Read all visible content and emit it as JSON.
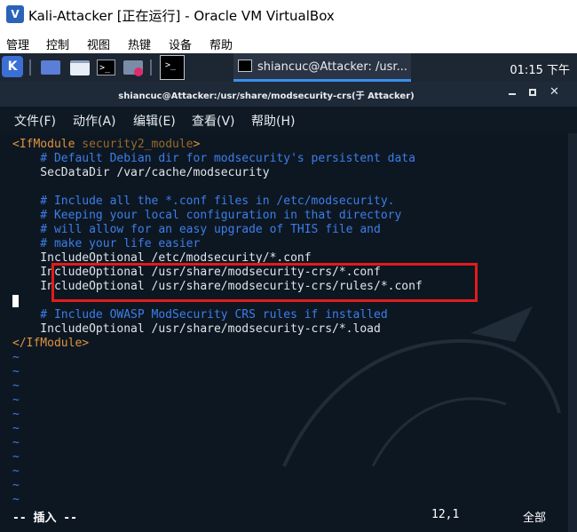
{
  "window": {
    "title": "Kali-Attacker [正在运行] - Oracle VM VirtualBox"
  },
  "vb_menu": [
    "管理",
    "控制",
    "视图",
    "热键",
    "设备",
    "帮助"
  ],
  "panel": {
    "task_label": "shiancuc@Attacker: /usr...",
    "clock": "01:15 下午"
  },
  "terminal": {
    "title": "shiancuc@Attacker:/usr/share/modsecurity-crs(于 Attacker)",
    "menu": [
      "文件(F)",
      "动作(A)",
      "编辑(E)",
      "查看(V)",
      "帮助(H)"
    ]
  },
  "editor": {
    "lines": {
      "l1_tag_open": "<IfModule ",
      "l1_attr": "security2_module",
      "l1_tag_close": ">",
      "l2": "    # Default Debian dir for modsecurity's persistent data",
      "l3": "    SecDataDir /var/cache/modsecurity",
      "l4": "",
      "l5": "    # Include all the *.conf files in /etc/modsecurity.",
      "l6": "    # Keeping your local configuration in that directory",
      "l7": "    # will allow for an easy upgrade of THIS file and",
      "l8": "    # make your life easier",
      "l9": "    IncludeOptional /etc/modsecurity/*.conf",
      "l10": "    IncludeOptional /usr/share/modsecurity-crs/*.conf",
      "l11": "    IncludeOptional /usr/share/modsecurity-crs/rules/*.conf",
      "l12": "",
      "l13": "    # Include OWASP ModSecurity CRS rules if installed",
      "l14": "    IncludeOptional /usr/share/modsecurity-crs/*.load",
      "l15": "</IfModule>"
    },
    "tilde": "~",
    "status": {
      "mode": "-- 插入 --",
      "position": "12,1",
      "scroll": "全部"
    }
  }
}
